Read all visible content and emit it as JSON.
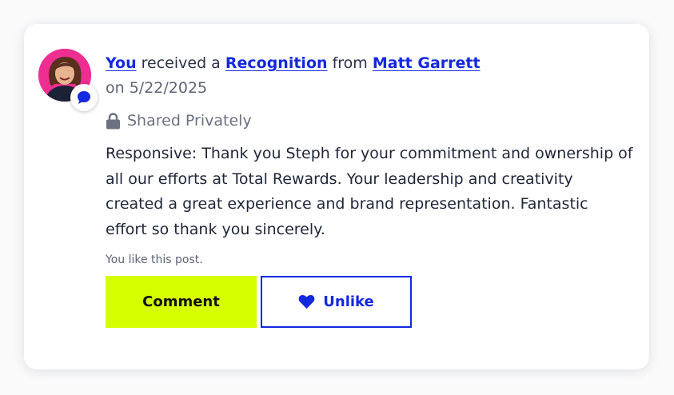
{
  "post": {
    "actor": "You",
    "verb_prefix": "received a",
    "item_type": "Recognition",
    "from_word": "from",
    "sender": "Matt Garrett",
    "date_text": "on 5/22/2025",
    "privacy": "Shared Privately",
    "message": "Responsive: Thank you Steph for your commitment and ownership of all our efforts at Total Rewards. Your leadership and creativity created a great experience and brand representation. Fantastic effort so thank you sincerely.",
    "like_status": "You like this post."
  },
  "actions": {
    "comment_label": "Comment",
    "unlike_label": "Unlike"
  },
  "icons": {
    "avatar_badge": "chat-bubble-icon",
    "privacy": "lock-icon",
    "unlike": "heart-icon"
  },
  "colors": {
    "link": "#1428e0",
    "comment_button": "#d6ff00",
    "avatar_background": "#ef2e91",
    "text": "#1f2638",
    "muted": "#6b7180"
  }
}
